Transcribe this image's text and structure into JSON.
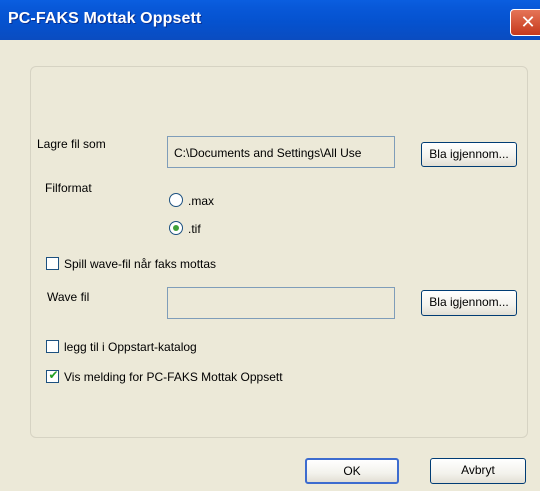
{
  "window": {
    "title": "PC-FAKS Mottak Oppsett"
  },
  "save_as": {
    "label": "Lagre fil som",
    "path_value": "C:\\Documents and Settings\\All Use",
    "browse_label": "Bla igjennom..."
  },
  "file_format": {
    "label": "Filformat",
    "options": [
      {
        "label": ".max",
        "selected": false
      },
      {
        "label": ".tif",
        "selected": true
      }
    ]
  },
  "play_wave": {
    "label": "Spill wave-fil når faks mottas",
    "checked": false
  },
  "wave_file": {
    "label": "Wave fil",
    "value": "",
    "browse_label": "Bla igjennom..."
  },
  "add_startup": {
    "label": "legg til i Oppstart-katalog",
    "checked": false
  },
  "show_message": {
    "label": "Vis melding for PC-FAKS Mottak Oppsett",
    "checked": true
  },
  "buttons": {
    "ok": "OK",
    "cancel": "Avbryt"
  },
  "colors": {
    "titlebar": "#0552cf",
    "dialog_bg": "#ece9d8",
    "check_green": "#21a121"
  }
}
